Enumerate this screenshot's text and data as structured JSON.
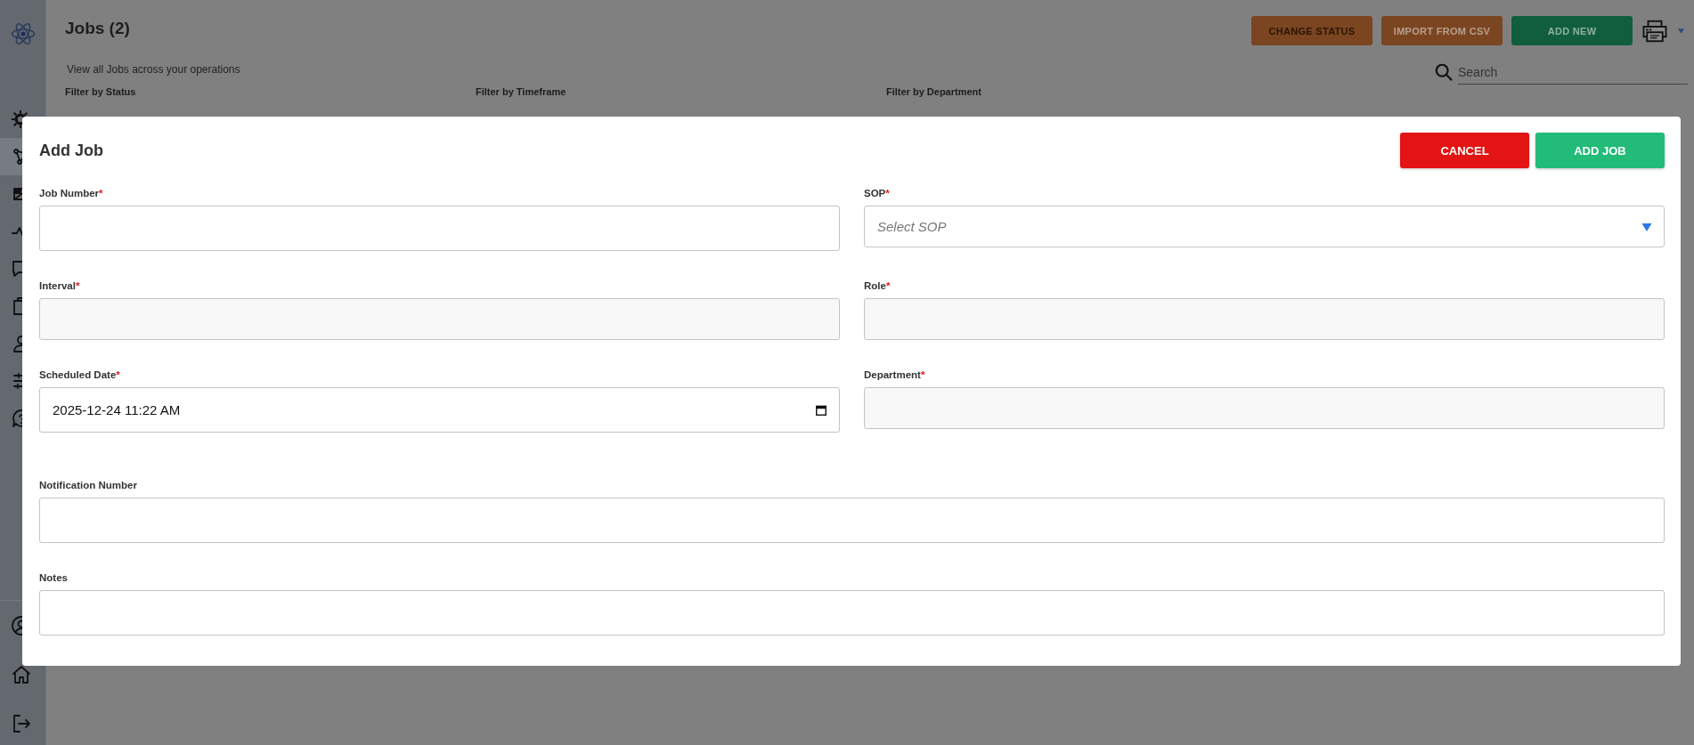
{
  "sidebar": {
    "items": [
      {
        "selected": false
      },
      {
        "selected": true
      },
      {
        "selected": false
      },
      {
        "selected": false
      },
      {
        "selected": false
      },
      {
        "selected": false
      },
      {
        "selected": false
      },
      {
        "selected": false
      },
      {
        "selected": false
      }
    ]
  },
  "page": {
    "title": "Jobs (2)",
    "subtitle": "View all Jobs across your operations",
    "actions": [
      {
        "label": "CHANGE STATUS",
        "kind": "orange",
        "disabled": true
      },
      {
        "label": "IMPORT FROM CSV",
        "kind": "orange",
        "disabled": false
      },
      {
        "label": "ADD NEW",
        "kind": "green",
        "disabled": false
      }
    ],
    "search": {
      "placeholder": "Search"
    },
    "filters": [
      {
        "label": "Filter by Status"
      },
      {
        "label": "Filter by Timeframe"
      },
      {
        "label": "Filter by Department"
      }
    ]
  },
  "dialog": {
    "title": "Add Job",
    "buttons": [
      {
        "label": "CANCEL",
        "kind": "danger"
      },
      {
        "label": "ADD JOB",
        "kind": "primary"
      }
    ],
    "rows": [
      [
        {
          "label": "Job Number",
          "mark": "*",
          "kind": "text",
          "disabled": false
        },
        {
          "label": "SOP",
          "mark": "*",
          "kind": "select",
          "placeholder": "Select SOP"
        }
      ],
      [
        {
          "label": "Interval",
          "mark": "*",
          "kind": "text",
          "disabled": true
        },
        {
          "label": "Role",
          "mark": "*",
          "kind": "text",
          "disabled": true
        }
      ],
      [
        {
          "label": "Scheduled Date",
          "mark": "*",
          "kind": "date",
          "value": "2025-12-24 11:22 AM"
        },
        {
          "label": "Department",
          "mark": "*",
          "kind": "text",
          "disabled": true
        }
      ],
      [
        {
          "label": "Notification Number",
          "kind": "text",
          "disabled": false
        }
      ],
      [
        {
          "label": "Notes",
          "kind": "text",
          "disabled": false
        }
      ]
    ]
  }
}
